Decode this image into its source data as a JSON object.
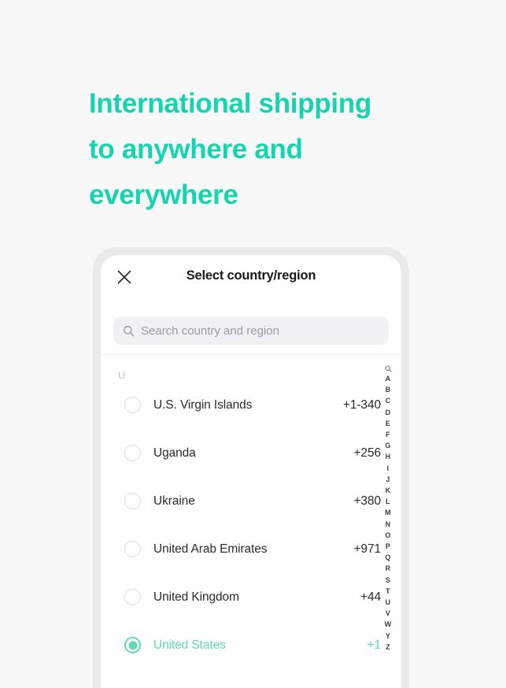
{
  "hero": {
    "lines": [
      "International shipping",
      "to anywhere and",
      "everywhere"
    ],
    "color": "#15d4b0"
  },
  "sheet": {
    "title": "Select country/region",
    "close_icon": "close-icon",
    "search": {
      "icon": "search-icon",
      "placeholder": "Search country and region",
      "value": ""
    },
    "section_letter": "U",
    "rows": [
      {
        "name": "U.S. Virgin Islands",
        "code": "+1-340",
        "selected": false
      },
      {
        "name": "Uganda",
        "code": "+256",
        "selected": false
      },
      {
        "name": "Ukraine",
        "code": "+380",
        "selected": false
      },
      {
        "name": "United Arab Emirates",
        "code": "+971",
        "selected": false
      },
      {
        "name": "United Kingdom",
        "code": "+44",
        "selected": false
      },
      {
        "name": "United States",
        "code": "+1",
        "selected": true
      }
    ],
    "selected_color": "#5fd9b5",
    "alpha_index": {
      "icon": "search-icon",
      "letters": [
        "A",
        "B",
        "C",
        "D",
        "E",
        "F",
        "G",
        "H",
        "I",
        "J",
        "K",
        "L",
        "M",
        "N",
        "O",
        "P",
        "Q",
        "R",
        "S",
        "T",
        "U",
        "V",
        "W",
        "Y",
        "Z"
      ]
    }
  }
}
